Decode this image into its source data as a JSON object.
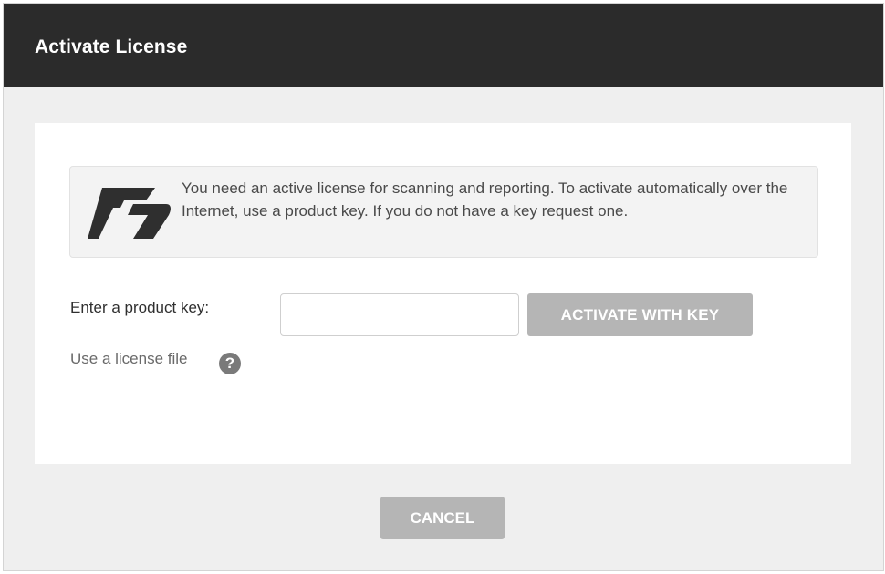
{
  "window": {
    "title": "Activate License"
  },
  "notice": {
    "text": "You need an active license for scanning and reporting. To activate automatically over the Internet, use a product key. If you do not have a key request one.",
    "icon": "product-logo-icon"
  },
  "product_key": {
    "label": "Enter a product key:",
    "value": "",
    "placeholder": ""
  },
  "buttons": {
    "activate_label": "ACTIVATE WITH KEY",
    "cancel_label": "CANCEL"
  },
  "license_file": {
    "link_label": "Use a license file",
    "help_icon": "?"
  },
  "colors": {
    "titlebar": "#2b2b2b",
    "button_disabled": "#b5b5b5",
    "dialog_bg": "#efefef"
  }
}
